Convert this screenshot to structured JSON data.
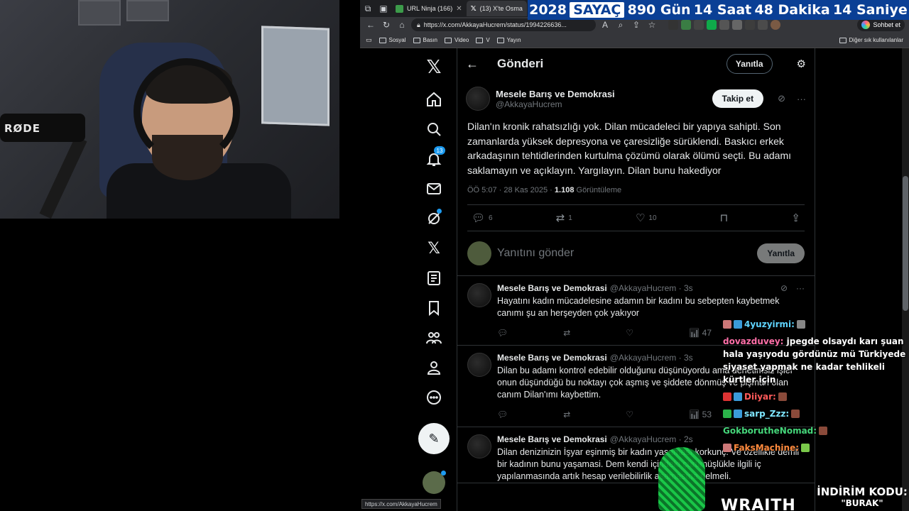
{
  "counter": {
    "year": "2028",
    "label": "SAYAÇ",
    "days": "890 Gün",
    "hours": "14 Saat",
    "minutes": "48 Dakika",
    "seconds": "14 Saniye"
  },
  "webcam": {
    "mic_brand": "RØDE"
  },
  "browser": {
    "tabs": [
      {
        "label": "URL Ninja (166)",
        "fav_color": "#3c9b4a"
      },
      {
        "label": "(13) X'te Osma",
        "fav_color": "#000000"
      }
    ],
    "url": "https://x.com/AkkayaHucrem/status/1994226636...",
    "copilot_label": "Sohbet et",
    "bookmarks": [
      "Sosyal",
      "Basın",
      "Video",
      "V",
      "Yayın"
    ],
    "other_bookmarks": "Diğer sık kullanılanlar",
    "status_url": "https://x.com/AkkayaHucrem"
  },
  "xnav": {
    "notifications_badge": "13"
  },
  "post_header": {
    "title": "Gönderi",
    "reply_label": "Yanıtla"
  },
  "post": {
    "name": "Mesele Barış ve Demokrasi",
    "handle": "@AkkayaHucrem",
    "follow_label": "Takip et",
    "text": "Dilan'ın kronik rahatsızlığı yok. Dilan mücadeleci bir yapıya sahipti. Son zamanlarda yüksek depresyona ve çaresizliğe sürüklendi. Baskıcı erkek arkadaşının tehtidlerinden kurtulma çözümü olarak ölümü seçti. Bu adamı saklamayın ve açıklayın. Yargılayın. Dilan bunu hakediyor",
    "time": "ÖÖ 5:07 · 28 Kas 2025 ·",
    "views": "1.108",
    "views_label": "Görüntüleme",
    "replies": "6",
    "reposts": "1",
    "likes": "10"
  },
  "reply_box": {
    "placeholder": "Yanıtını gönder",
    "button": "Yanıtla"
  },
  "replies": [
    {
      "name": "Mesele Barış ve Demokrasi",
      "handle": "@AkkayaHucrem · 3s",
      "text": "Hayatını kadın mücadelesine adamın bir kadını bu sebepten kaybetmek canımı şu an herşeyden çok yakıyor",
      "views": "47"
    },
    {
      "name": "Mesele Barış ve Demokrasi",
      "handle": "@AkkayaHucrem · 3s",
      "text": "Dilan bu adamı kontrol edebilir olduğunu düşünüyordu ama denetimsiz işler onun düşündüğü bu noktayı çok aşmış ve şiddete dönmüş ve pişman olan canım Dilan'ımı kaybettim.",
      "views": "53"
    },
    {
      "name": "Mesele Barış ve Demokrasi",
      "handle": "@AkkayaHucrem · 2s",
      "text": "Dilan denizinizin İşyar eşinmiş bir kadın yaşaması korkunç. Ve özellikle demli bir kadının bunu yaşamasi. Dem kendi içindeki çürümüşlükle ilgili iç yapılanmasında artık hesap verilebilirlik aşamasına gelmeli.",
      "views": ""
    }
  ],
  "chat": [
    {
      "user": "4yuzyirmi:",
      "color": "#5fd4ff",
      "msg": ""
    },
    {
      "user": "dovazduvey:",
      "color": "#ff6fa8",
      "msg": "jpegde olsaydı karı şuan hala yaşıyodu gördünüz mü Türkiyede siyaset yapmak ne kadar tehlikeli kürtler için"
    },
    {
      "user": "Diiyar:",
      "color": "#ff5a5a",
      "msg": ""
    },
    {
      "user": "sarp_Zzz:",
      "color": "#7fe6ff",
      "msg": ""
    },
    {
      "user": "GokborutheNomad:",
      "color": "#45d67a",
      "msg": ""
    },
    {
      "user": "FaksMachine:",
      "color": "#ff8a3d",
      "msg": ""
    }
  ],
  "promo": {
    "line1": "İNDİRİM KODU:",
    "line2": "\"BURAK\"",
    "brand": "WRAITH"
  }
}
